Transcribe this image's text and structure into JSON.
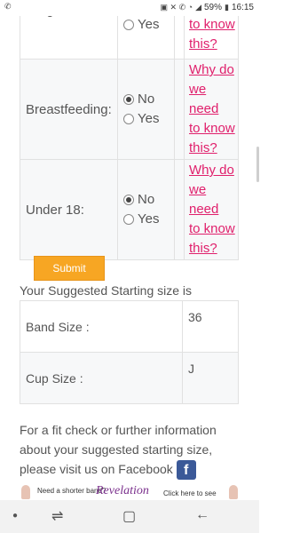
{
  "status_bar": {
    "left_icon": "whatsapp-icon",
    "battery": "59%",
    "time": "16:15"
  },
  "form": {
    "rows": [
      {
        "label": "Pregnant:",
        "options": [
          "Yes"
        ],
        "selected": "",
        "why": "to know this?"
      },
      {
        "label": "Breastfeeding:",
        "options": [
          "No",
          "Yes"
        ],
        "selected": "No",
        "why": [
          "Why do",
          "we need",
          "to know",
          "this?"
        ]
      },
      {
        "label": "Under 18:",
        "options": [
          "No",
          "Yes"
        ],
        "selected": "No",
        "why": [
          "Why do",
          "we need",
          "to know",
          "this?"
        ]
      }
    ]
  },
  "submit_label": "Submit",
  "suggest_heading": "Your Suggested Starting size is",
  "results": {
    "band_label": "Band Size :",
    "band_value": "36",
    "cup_label": "Cup Size :",
    "cup_value": "J"
  },
  "info_text": "For a fit check or further information about your suggested starting size, please visit us on Facebook",
  "facebook_icon": "facebook-icon",
  "banner": {
    "left_text": "Need a shorter band?",
    "brand": "Revelation",
    "right_text": "Click here to see"
  },
  "colors": {
    "accent_link": "#e0206c",
    "submit_bg": "#f7a623"
  }
}
